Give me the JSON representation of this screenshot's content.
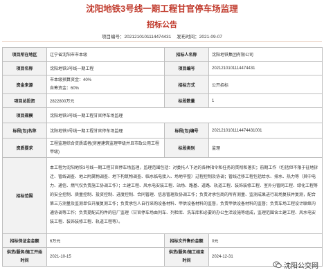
{
  "header": {
    "title": "沈阳地铁3号线一期工程甘官停车场监理",
    "subtitle": "招标公告",
    "project_no_label": "项目编号：",
    "project_no": "2021210101114474431",
    "publish_label": "发布时间：",
    "publish_date": "2021-09-07"
  },
  "table": {
    "location_label": "项目所在地区",
    "location": "辽宁省沈阳市市本级",
    "tenderer_label": "招标人名称",
    "tenderer": "沈阳地铁集团有限公司",
    "project_name_label": "项目名称",
    "project_name": "沈阳地铁3号线一期工程",
    "project_no_label": "项目编号",
    "project_no": "2021210101114474431",
    "fund_source_label": "资金来源",
    "fund_source_1": "市本级预算资金：40%",
    "fund_source_2": "自筹资金：60%",
    "tender_mode_label": "招标方式",
    "tender_mode": "公开招标",
    "total_invest_label": "项目总投资",
    "total_invest": "2822800万元",
    "section_count_label": "标段数量",
    "section_count": "1",
    "scale_label": "项目规模",
    "scale": "沈阳地铁3号线一期工程甘官停车场监理",
    "section_name_label": "标段(包)名称",
    "section_name": "沈阳地铁3号线一期工程甘官停车场监理",
    "section_no_label": "标段(包)编号",
    "section_no": "2021210101114474431001",
    "qualification_label": "资质要求",
    "qualification": "工程监理综合资质或者(房屋建筑监理甲级并且市政公用工程甲级)",
    "category_label": "标段类别",
    "category": "监理",
    "scope_label": "招标范围",
    "scope": "本工程为沈阳地铁3号线一期工程甘官停车场监理，监理范围包括：对委托人下达的各种指令和任务的贯彻和落实；前期工作（包括但不限于征地拆迁、管线调查、地上附属物调查、地下构筑物调查、临水临电接入、场地平整）过程控制及协调；管线迁移工程包括给水、排水、热力等（其中电力、通信、燃气仅负责施工协调工作）；土建工程、风水电安装工程、站场、路基、道路、轨道工程、装饰装修工程、室外分管网工程、绿化工程等的安全控制、质量控制、投资控制、进度控制、合同管理、信息管理及协调工作；负责对承包商的所有测量、监测成果进行现场复核并复测，配合第三方测量及监测单位开展复测工作；负责承包人自行采购设备材料、甲供设备材料的监督，负责甲供设备材料的监督；负责车场工程设计联络沟通协调等工作；负责提配式构件的驻厂监理（甘官停车场由列车、列检库、洗车库和必要的办公生活设施等组成，监理范围含土建工程、风水电安装工程、装饰装修工程、轨道工程等）。",
    "deposit_label": "招标保证金金额",
    "deposit": "6万元",
    "doc_fee_label": "招标文件售价金额",
    "doc_fee": "0元",
    "start_label": "供货/服务/施工开始时间",
    "start": "2021-10-15",
    "end_label": "供货/服务/施工结束时间",
    "end": "2024-12-31"
  },
  "watermark": {
    "text": "沈阳公交网",
    "icon": "wechat-icon"
  },
  "colors": {
    "title": "#c0392b",
    "label_bg": "#f2f2f2",
    "border": "#bdbdbd"
  }
}
